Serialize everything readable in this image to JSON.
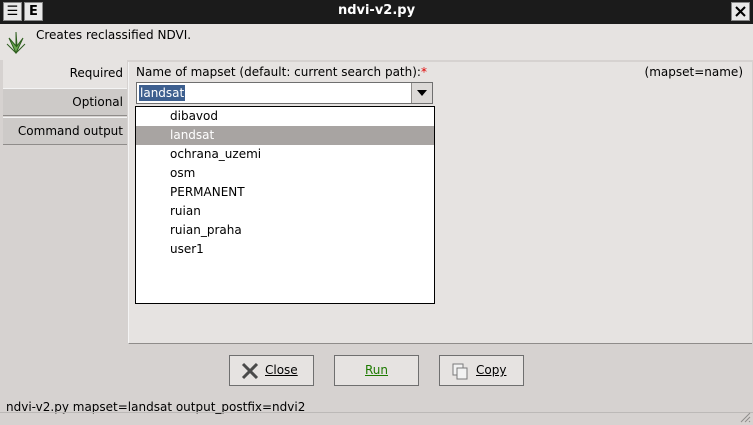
{
  "window": {
    "title": "ndvi-v2.py",
    "left_buttons": [
      "☰",
      "E"
    ]
  },
  "description": {
    "text": "Creates reclassified NDVI.",
    "icon": "grass-icon"
  },
  "tabs": [
    {
      "label": "Required",
      "active": true
    },
    {
      "label": "Optional",
      "active": false
    },
    {
      "label": "Command output",
      "active": false
    }
  ],
  "field": {
    "label": "Name of mapset (default: current search path):",
    "required_marker": "*",
    "hint": "(mapset=name)",
    "value": "landsat"
  },
  "dropdown_options": [
    "dibavod",
    "landsat",
    "ochrana_uzemi",
    "osm",
    "PERMANENT",
    "ruian",
    "ruian_praha",
    "user1"
  ],
  "selected_option": "landsat",
  "buttons": {
    "close": "Close",
    "run": "Run",
    "copy": "Copy"
  },
  "status": {
    "text": "ndvi-v2.py mapset=landsat output_postfix=ndvi2"
  },
  "colors": {
    "titlebar": "#1b1b1b",
    "selection": "#3d5f8f",
    "list_highlight": "#a8a4a2",
    "run_label": "#1d7a00",
    "required_marker": "#e00000"
  }
}
